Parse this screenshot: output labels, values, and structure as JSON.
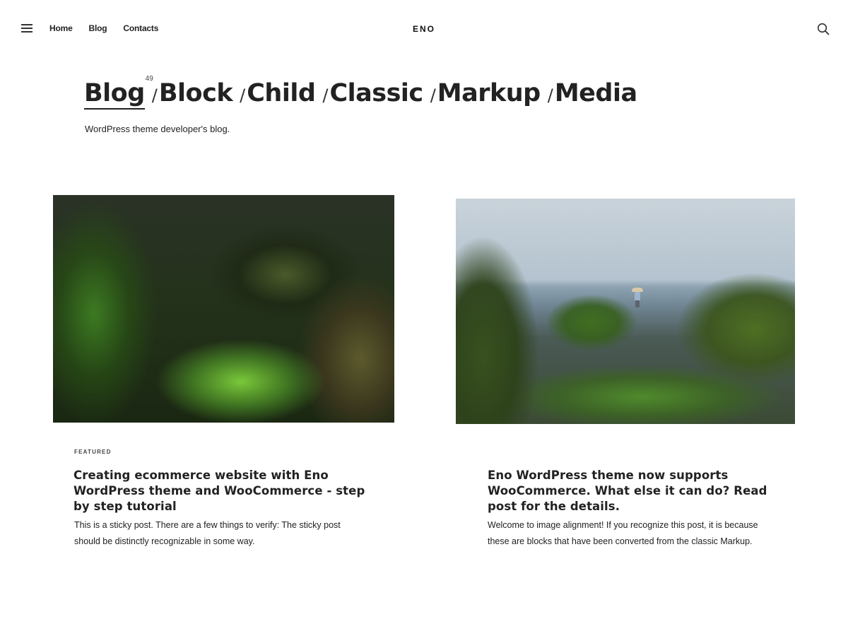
{
  "header": {
    "nav": [
      {
        "label": "Home"
      },
      {
        "label": "Blog"
      },
      {
        "label": "Contacts"
      }
    ],
    "logo": "ENO",
    "icons": {
      "menu": "hamburger-menu-icon",
      "search": "search-icon"
    }
  },
  "breadcrumb": {
    "items": [
      {
        "label": "Blog",
        "count": "49",
        "active": true
      },
      {
        "label": "Block"
      },
      {
        "label": "Child"
      },
      {
        "label": "Classic"
      },
      {
        "label": "Markup"
      },
      {
        "label": "Media"
      }
    ],
    "separator": "/"
  },
  "tagline": "WordPress theme developer's blog.",
  "posts": [
    {
      "badge": "FEATURED",
      "title": "Creating ecommerce website with Eno WordPress theme and WooCommerce - step by step tutorial",
      "excerpt": "This is a sticky post. There are a few things to verify: The sticky post should be distinctly recognizable in some way."
    },
    {
      "title": "Eno WordPress theme now supports WooCommerce. What else it can do? Read post for the details.",
      "excerpt": "Welcome to image alignment! If you recognize this post, it is because these are blocks that have been converted from the classic Markup."
    }
  ],
  "colors": {
    "text": "#222222",
    "background": "#ffffff"
  }
}
